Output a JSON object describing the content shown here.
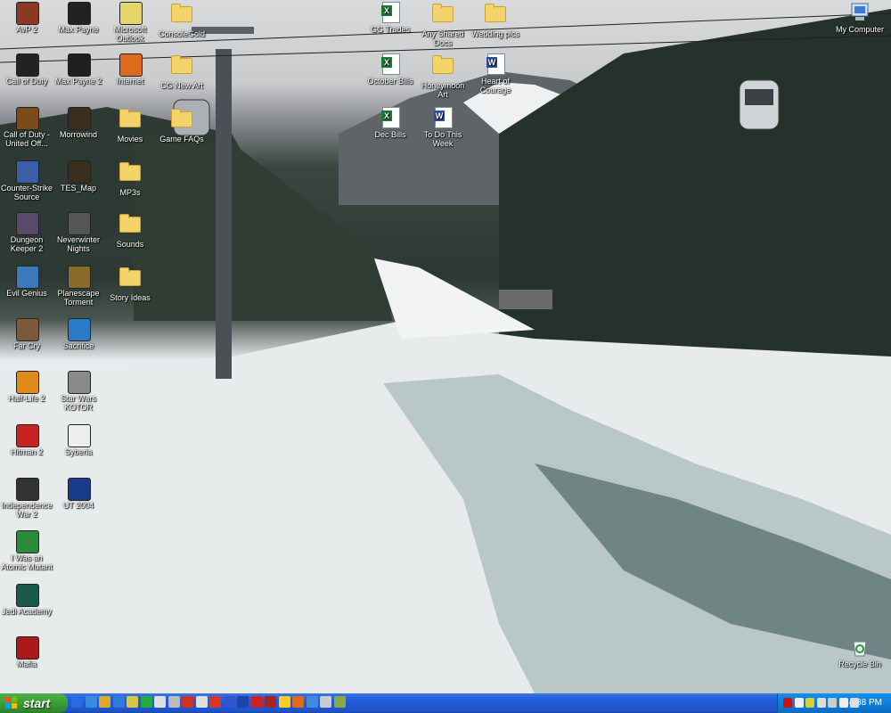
{
  "desktop": {
    "icons": [
      {
        "name": "AvP 2",
        "icon": "avp2-icon",
        "color": "#8a3a22"
      },
      {
        "name": "Max Payne",
        "icon": "max-payne-icon",
        "color": "#222222"
      },
      {
        "name": "Microsoft Outlook",
        "icon": "outlook-icon",
        "color": "#e6d66a"
      },
      {
        "name": "ConsoleGold",
        "icon": "folder-icon"
      },
      {
        "name": "GG Trades",
        "icon": "excel-icon"
      },
      {
        "name": "Any Shared Docs",
        "icon": "folder-icon"
      },
      {
        "name": "Wedding pics",
        "icon": "folder-icon"
      },
      {
        "name": "My Computer",
        "icon": "computer-icon"
      },
      {
        "name": "Call of Duty",
        "icon": "call-of-duty-icon",
        "color": "#222222"
      },
      {
        "name": "Max Payne 2",
        "icon": "max-payne-2-icon",
        "color": "#1f1f1f"
      },
      {
        "name": "Internet",
        "icon": "firefox-icon",
        "color": "#e06a1b"
      },
      {
        "name": "CG New Art",
        "icon": "folder-icon"
      },
      {
        "name": "October Bills",
        "icon": "excel-icon"
      },
      {
        "name": "Honeymoon Art",
        "icon": "folder-icon"
      },
      {
        "name": "Heart of Courage",
        "icon": "word-icon"
      },
      {
        "name": "Call of Duty - United Off...",
        "icon": "call-of-duty-uo-icon",
        "color": "#7a4a1a"
      },
      {
        "name": "Morrowind",
        "icon": "morrowind-icon",
        "color": "#3a2e1e"
      },
      {
        "name": "Movies",
        "icon": "folder-icon"
      },
      {
        "name": "Game FAQs",
        "icon": "folder-icon"
      },
      {
        "name": "Dec Bills",
        "icon": "excel-icon"
      },
      {
        "name": "To Do This Week",
        "icon": "word-icon"
      },
      {
        "name": "Counter-Strike Source",
        "icon": "counter-strike-icon",
        "color": "#3a5fa8"
      },
      {
        "name": "TES_Map",
        "icon": "tes-map-icon",
        "color": "#3a2e1e"
      },
      {
        "name": "MP3s",
        "icon": "folder-icon"
      },
      {
        "name": "Dungeon Keeper 2",
        "icon": "dungeon-keeper-icon",
        "color": "#5a4a6a"
      },
      {
        "name": "Neverwinter Nights",
        "icon": "neverwinter-icon",
        "color": "#555555"
      },
      {
        "name": "Sounds",
        "icon": "folder-icon"
      },
      {
        "name": "Evil Genius",
        "icon": "evil-genius-icon",
        "color": "#3a7ab8"
      },
      {
        "name": "Planescape Torment",
        "icon": "planescape-icon",
        "color": "#8a6a2a"
      },
      {
        "name": "Story Ideas",
        "icon": "folder-icon"
      },
      {
        "name": "Far Cry",
        "icon": "far-cry-icon",
        "color": "#7a5a3a"
      },
      {
        "name": "Sacrifice",
        "icon": "sacrifice-icon",
        "color": "#2a7ac8"
      },
      {
        "name": "Half-Life 2",
        "icon": "half-life-2-icon",
        "color": "#e08a1a"
      },
      {
        "name": "Star Wars KOTOR",
        "icon": "kotor-icon",
        "color": "#8a8a8a"
      },
      {
        "name": "Hitman 2",
        "icon": "hitman-2-icon",
        "color": "#c82222"
      },
      {
        "name": "Syberia",
        "icon": "syberia-icon",
        "color": "#eeeeee"
      },
      {
        "name": "Independence War 2",
        "icon": "independence-war-icon",
        "color": "#333333"
      },
      {
        "name": "UT 2004",
        "icon": "ut2004-icon",
        "color": "#1a3a8a"
      },
      {
        "name": "I Was an Atomic Mutant",
        "icon": "atomic-mutant-icon",
        "color": "#2a8a3a"
      },
      {
        "name": "Jedi Academy",
        "icon": "jedi-academy-icon",
        "color": "#1a5a4a"
      },
      {
        "name": "Mafia",
        "icon": "mafia-icon",
        "color": "#aa1a1a"
      },
      {
        "name": "Recycle Bin",
        "icon": "recycle-bin-icon"
      }
    ]
  },
  "taskbar": {
    "start_label": "start",
    "quick_launch": [
      {
        "icon": "ie-icon",
        "color": "#2a6ae0"
      },
      {
        "icon": "outlook-express-icon",
        "color": "#3a8ae0"
      },
      {
        "icon": "bug-icon",
        "color": "#ddaa22"
      },
      {
        "icon": "ie2-icon",
        "color": "#2a7ae0"
      },
      {
        "icon": "outlook-icon",
        "color": "#d6c64a"
      },
      {
        "icon": "messenger-icon",
        "color": "#22aa44"
      },
      {
        "icon": "media-icon",
        "color": "#e0e0e0"
      },
      {
        "icon": "printer-icon",
        "color": "#bbbbbb"
      },
      {
        "icon": "globe-icon",
        "color": "#cc3322"
      },
      {
        "icon": "disc-icon",
        "color": "#e0e0e0"
      },
      {
        "icon": "star-icon",
        "color": "#dd3322"
      },
      {
        "icon": "music-icon",
        "color": "#3355cc"
      },
      {
        "icon": "ut-icon",
        "color": "#2244aa"
      },
      {
        "icon": "net-icon",
        "color": "#cc2222"
      },
      {
        "icon": "cd-icon",
        "color": "#aa2222"
      },
      {
        "icon": "smile-icon",
        "color": "#ffcc22"
      },
      {
        "icon": "fox-icon",
        "color": "#e06a1b"
      },
      {
        "icon": "search-icon",
        "color": "#4488dd"
      },
      {
        "icon": "lock-icon",
        "color": "#cccccc"
      },
      {
        "icon": "chart-icon",
        "color": "#88aa44"
      }
    ],
    "tray_icons": [
      {
        "icon": "ati-icon",
        "color": "#cc1111"
      },
      {
        "icon": "network-icon",
        "color": "#eeeeee"
      },
      {
        "icon": "antivirus-icon",
        "color": "#ddcc33"
      },
      {
        "icon": "speaker-icon",
        "color": "#dddddd"
      },
      {
        "icon": "battery-icon",
        "color": "#cccccc"
      },
      {
        "icon": "clipboard-icon",
        "color": "#eeeeee"
      },
      {
        "icon": "wifi-icon",
        "color": "#dddddd"
      }
    ],
    "clock": "4:38 PM"
  }
}
